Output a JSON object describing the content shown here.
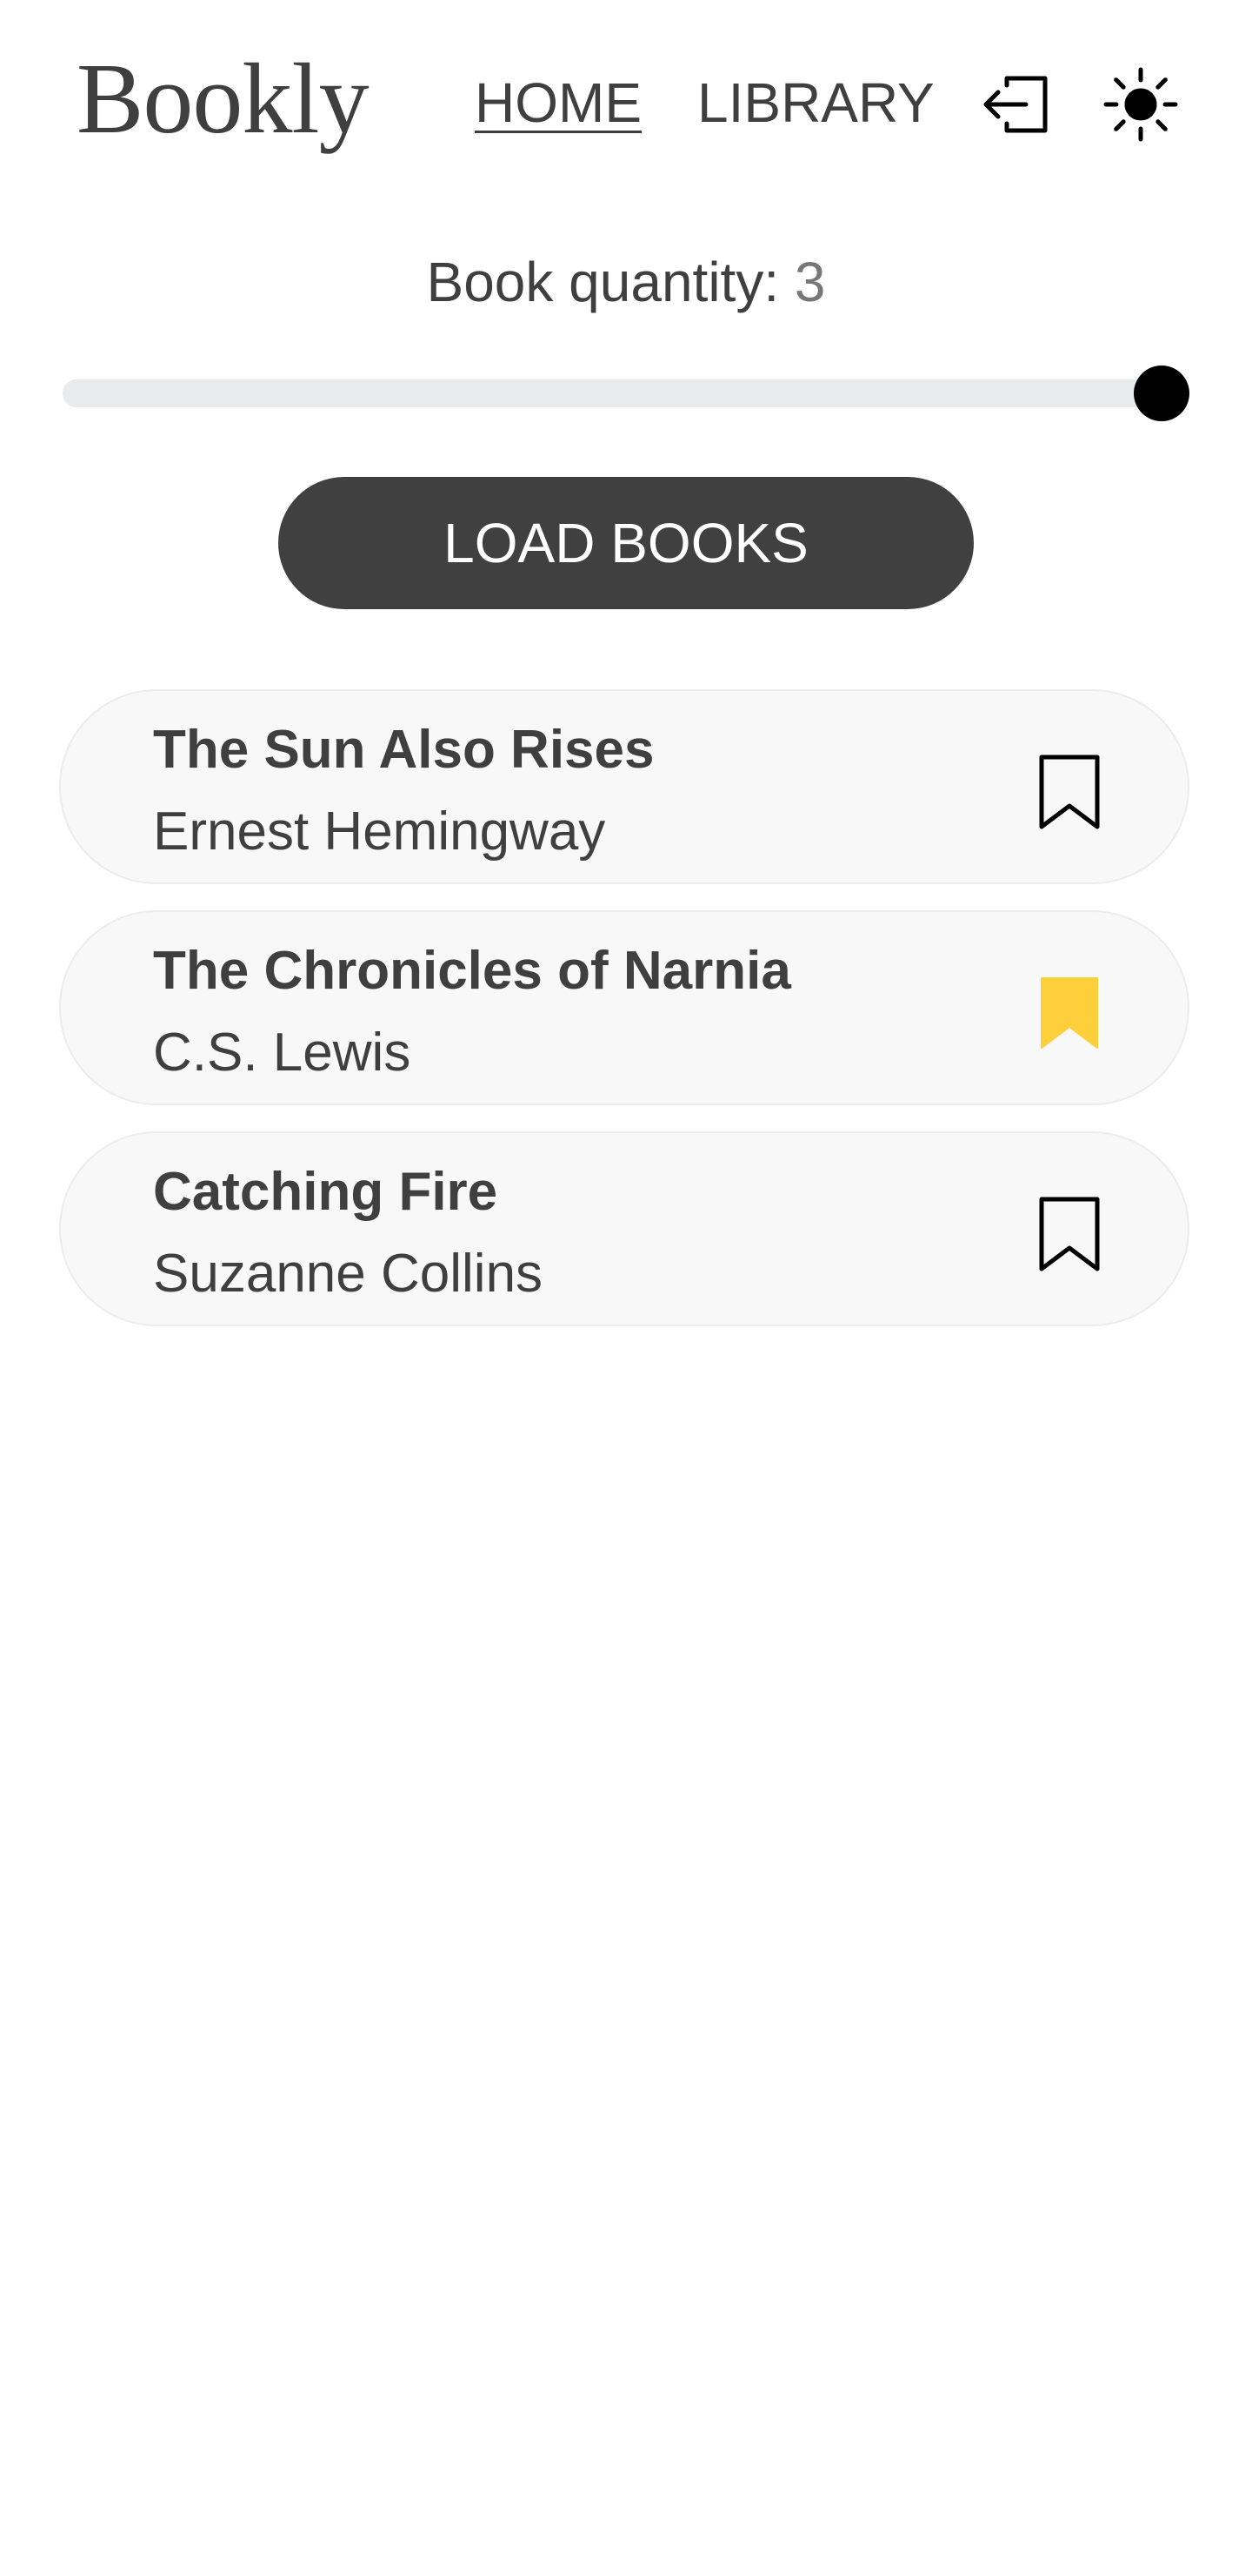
{
  "header": {
    "logo": "Bookly",
    "nav": [
      {
        "label": "HOME",
        "active": true
      },
      {
        "label": "LIBRARY",
        "active": false
      }
    ],
    "logout_icon": "logout-icon",
    "theme_icon": "sun-icon"
  },
  "controls": {
    "quantity_label": "Book quantity:",
    "quantity_value": "3",
    "slider": {
      "value": 3,
      "max": 3,
      "fraction": 1.0
    },
    "load_button": "LOAD BOOKS"
  },
  "books": [
    {
      "title": "The Sun Also Rises",
      "author": "Ernest Hemingway",
      "bookmarked": false
    },
    {
      "title": "The Chronicles of Narnia",
      "author": "C.S. Lewis",
      "bookmarked": true
    },
    {
      "title": "Catching Fire",
      "author": "Suzanne Collins",
      "bookmarked": false
    }
  ],
  "colors": {
    "text": "#3f3f3f",
    "button_bg": "#404040",
    "bookmark_active": "#fdd03b",
    "card_bg": "#f8f8f8",
    "track": "#e8ecee"
  }
}
